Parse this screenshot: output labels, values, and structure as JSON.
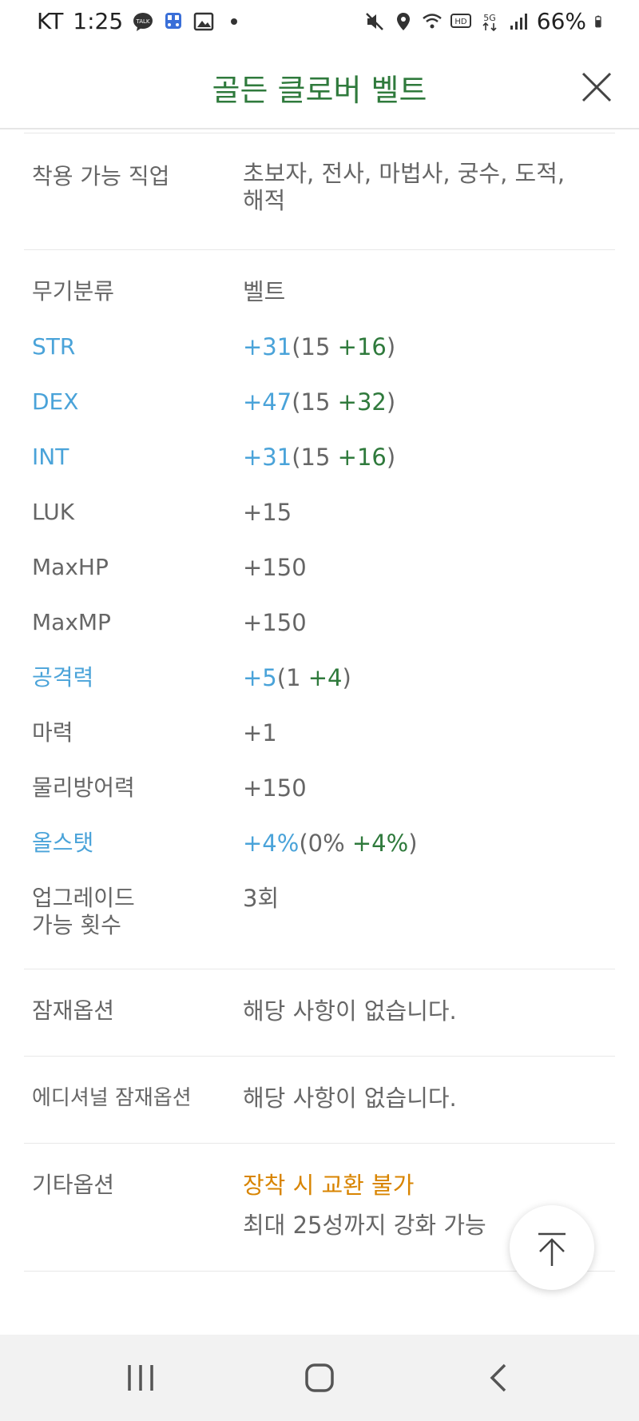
{
  "status_bar": {
    "carrier": "KT",
    "time": "1:25",
    "battery": "66%",
    "left_icons": [
      "talk-icon",
      "transit-icon",
      "gallery-icon",
      "dot-icon"
    ],
    "right_icons": [
      "mute-icon",
      "location-icon",
      "wifi-icon",
      "hd-icon",
      "5g-icon",
      "signal-icon",
      "battery-icon"
    ]
  },
  "header": {
    "title": "골든 클로버 벨트"
  },
  "rows": [
    {
      "label": "착용 가능 직업",
      "value_line1": "초보자, 전사, 마법사, 궁수, 도적,",
      "value_line2": "해적"
    },
    {
      "label": "무기분류",
      "value": "벨트"
    },
    {
      "label": "STR",
      "total": "+31",
      "base": "15",
      "bonus": "+16"
    },
    {
      "label": "DEX",
      "total": "+47",
      "base": "15",
      "bonus": "+32"
    },
    {
      "label": "INT",
      "total": "+31",
      "base": "15",
      "bonus": "+16"
    },
    {
      "label": "LUK",
      "value": "+15"
    },
    {
      "label": "MaxHP",
      "value": "+150"
    },
    {
      "label": "MaxMP",
      "value": "+150"
    },
    {
      "label": "공격력",
      "total": "+5",
      "base": "1",
      "bonus": "+4"
    },
    {
      "label": "마력",
      "value": "+1"
    },
    {
      "label": "물리방어력",
      "value": "+150"
    },
    {
      "label": "올스탯",
      "total": "+4%",
      "base": "0%",
      "bonus": "+4%"
    },
    {
      "label_line1": "업그레이드",
      "label_line2": "가능 횟수",
      "value": "3회"
    },
    {
      "label": "잠재옵션",
      "value": "해당 사항이 없습니다."
    },
    {
      "label": "에디셔널 잠재옵션",
      "value": "해당 사항이 없습니다."
    },
    {
      "label": "기타옵션",
      "value_line1": "장착 시 교환 불가",
      "value_line2": "최대 25성까지 강화 가능"
    }
  ],
  "colors": {
    "title_green": "#2f7a3c",
    "stat_blue": "#4aa3d9",
    "bonus_green": "#2f7a3c",
    "notice_orange": "#d88400"
  }
}
